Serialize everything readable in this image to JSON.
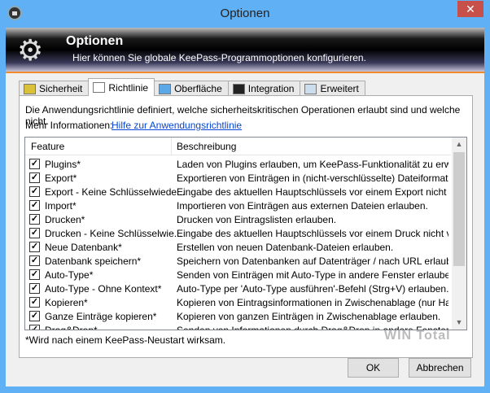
{
  "window": {
    "title": "Optionen",
    "close": "✕"
  },
  "banner": {
    "title": "Optionen",
    "subtitle": "Hier können Sie globale KeePass-Programmoptionen konfigurieren."
  },
  "tabs": [
    {
      "label": "Sicherheit",
      "icon": "key-icon"
    },
    {
      "label": "Richtlinie",
      "icon": "list-icon",
      "active": true
    },
    {
      "label": "Oberfläche",
      "icon": "window-icon"
    },
    {
      "label": "Integration",
      "icon": "console-icon"
    },
    {
      "label": "Erweitert",
      "icon": "checklist-icon"
    }
  ],
  "policy": {
    "description": "Die Anwendungsrichtlinie definiert, welche sicherheitskritischen Operationen erlaubt sind und welche nicht.",
    "more_label": "Mehr Informationen:",
    "link": "Hilfe zur Anwendungsrichtlinie"
  },
  "list": {
    "columns": [
      "Feature",
      "Beschreibung"
    ],
    "rows": [
      {
        "feature": "Plugins*",
        "desc": "Laden von Plugins erlauben, um KeePass-Funktionalität zu erweite...",
        "checked": true
      },
      {
        "feature": "Export*",
        "desc": "Exportieren von Einträgen in (nicht-verschlüsselte) Dateiformate erl...",
        "checked": true
      },
      {
        "feature": "Export - Keine Schlüsselwiede...",
        "desc": "Eingabe des aktuellen Hauptschlüssels vor einem Export nicht verl...",
        "checked": true
      },
      {
        "feature": "Import*",
        "desc": "Importieren von Einträgen aus externen Dateien erlauben.",
        "checked": true
      },
      {
        "feature": "Drucken*",
        "desc": "Drucken von Eintragslisten erlauben.",
        "checked": true
      },
      {
        "feature": "Drucken - Keine Schlüsselwie...",
        "desc": "Eingabe des aktuellen Hauptschlüssels vor einem Druck nicht verl...",
        "checked": true
      },
      {
        "feature": "Neue Datenbank*",
        "desc": "Erstellen von neuen Datenbank-Dateien erlauben.",
        "checked": true
      },
      {
        "feature": "Datenbank speichern*",
        "desc": "Speichern von Datenbanken auf Datenträger / nach URL erlauben.",
        "checked": true
      },
      {
        "feature": "Auto-Type*",
        "desc": "Senden von Einträgen mit Auto-Type in andere Fenster erlauben.",
        "checked": true
      },
      {
        "feature": "Auto-Type - Ohne Kontext*",
        "desc": "Auto-Type per 'Auto-Type ausführen'-Befehl (Strg+V) erlauben.",
        "checked": true
      },
      {
        "feature": "Kopieren*",
        "desc": "Kopieren von Eintragsinformationen in Zwischenablage (nur Hauptf...",
        "checked": true
      },
      {
        "feature": "Ganze Einträge kopieren*",
        "desc": "Kopieren von ganzen Einträgen in Zwischenablage erlauben.",
        "checked": true
      },
      {
        "feature": "Drag&Drop*",
        "desc": "Senden von Informationen durch Drag&Drop in andere Fenster erlau...",
        "checked": true
      }
    ]
  },
  "note": "*Wird nach einem KeePass-Neustart wirksam.",
  "watermark": "WIN Total",
  "buttons": {
    "ok": "OK",
    "cancel": "Abbrechen"
  }
}
